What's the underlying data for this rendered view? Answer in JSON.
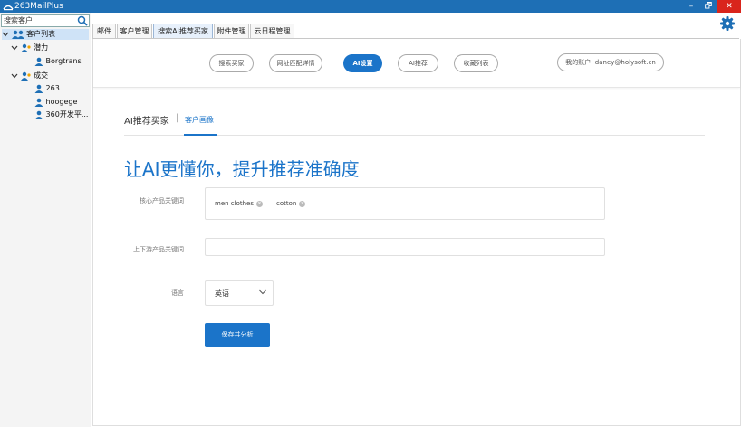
{
  "app": {
    "title": "263MailPlus"
  },
  "window_controls": {
    "minimize": "–",
    "maximize": "🗗",
    "close": "✕"
  },
  "sidebar": {
    "search_placeholder": "搜索客户",
    "tree": {
      "root": "客户列表",
      "group_potential": "潜力",
      "potential_items": [
        "Borgtrans"
      ],
      "group_deal": "成交",
      "deal_items": [
        "263",
        "hoogege",
        "360开发平..."
      ]
    }
  },
  "tabs": [
    "邮件",
    "客户管理",
    "搜索AI推荐买家",
    "附件管理",
    "云日程管理"
  ],
  "active_tab": "搜索AI推荐买家",
  "topnav": {
    "pills": [
      "搜索买家",
      "网址匹配详情",
      "AI设置",
      "AI推荐",
      "收藏列表"
    ],
    "active": "AI设置",
    "account": "我的账户: daney@holysoft.cn"
  },
  "subnav": {
    "title": "AI推荐买家",
    "separator": "|",
    "active": "客户画像"
  },
  "headline": "让AI更懂你，提升推荐准确度",
  "form": {
    "core_keywords_label": "核心产品关键词",
    "core_keywords": [
      "men clothes",
      "cotton"
    ],
    "updown_keywords_label": "上下游产品关键词",
    "updown_keywords_value": "",
    "language_label": "语言",
    "language_value": "英语",
    "submit": "保存并分析"
  },
  "colors": {
    "accent": "#1b74c9",
    "titlebar": "#1e6fb5",
    "close": "#d9251c"
  }
}
